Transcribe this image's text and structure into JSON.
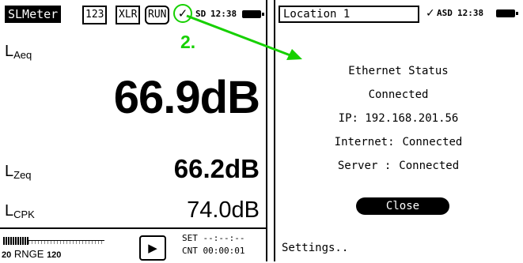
{
  "left": {
    "status_bar": {
      "title": "SLMeter",
      "tags": [
        "123",
        "XLR",
        "RUN"
      ],
      "check": "✓",
      "sd": "SD",
      "time": "12:38"
    },
    "step": "2.",
    "readings": {
      "laeq": {
        "main": "L",
        "sub": "Aeq",
        "value": "66.9dB"
      },
      "lzeq": {
        "main": "L",
        "sub": "Zeq",
        "value": "66.2dB"
      },
      "lcpk": {
        "main": "L",
        "sub": "CPK",
        "value": "74.0dB"
      }
    },
    "bottom": {
      "range_low": "20",
      "range_label": "RNGE",
      "range_high": "120",
      "set": "SET --:--:--",
      "cnt": "CNT 00:00:01"
    }
  },
  "right": {
    "status_bar": {
      "location": "Location 1",
      "check": "✓",
      "asd": "ASD",
      "time": "12:38"
    },
    "ethernet_title": "Ethernet Status",
    "ethernet_state": "Connected",
    "ip_line": "IP: 192.168.201.56",
    "internet_label": "Internet:",
    "internet_value": "Connected",
    "server_label": "Server :",
    "server_value": "Connected",
    "close_label": "Close",
    "settings_label": "Settings.."
  },
  "colors": {
    "accent": "#16d000",
    "text": "#000000",
    "background": "#ffffff"
  }
}
